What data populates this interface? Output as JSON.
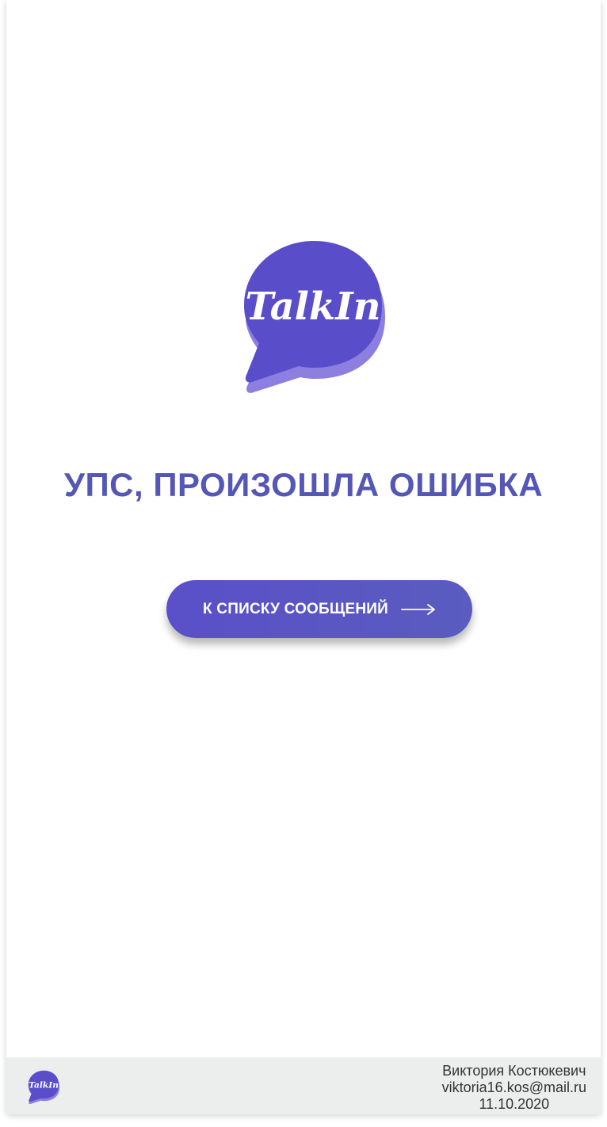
{
  "logo": {
    "text": "TalkIn",
    "icon": "chat-bubble-logo-icon",
    "color_primary": "#5a4dc9",
    "color_shadow": "#8c7fe0"
  },
  "error": {
    "title": "УПС, ПРОИЗОШЛА ОШИБКА",
    "color": "#5557b6"
  },
  "cta": {
    "label": "К СПИСКУ СООБЩЕНИЙ",
    "icon": "arrow-right-icon",
    "color": "#5a55c4"
  },
  "footer": {
    "logo_text": "TalkIn",
    "author": "Виктория Костюкевич",
    "email": "viktoria16.kos@mail.ru",
    "date": "11.10.2020",
    "background": "#eceeee"
  }
}
